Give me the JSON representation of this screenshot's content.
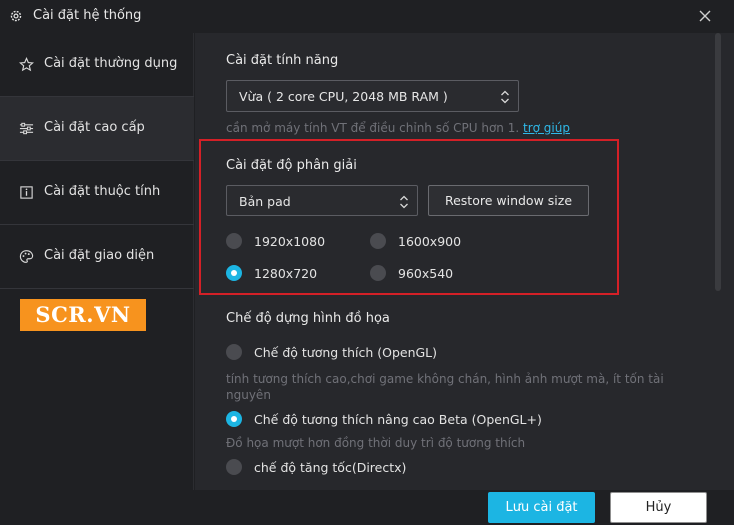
{
  "window": {
    "title": "Cài đặt hệ thống"
  },
  "sidebar": {
    "items": [
      {
        "label": "Cài đặt thường dụng",
        "icon": "star-icon"
      },
      {
        "label": "Cài đặt cao cấp",
        "icon": "sliders-icon"
      },
      {
        "label": "Cài đặt thuộc tính",
        "icon": "info-icon"
      },
      {
        "label": "Cài đặt giao diện",
        "icon": "palette-icon"
      }
    ],
    "active_index": 1
  },
  "watermark": {
    "text": "SCR.VN",
    "color": "#f7931e"
  },
  "features": {
    "title": "Cài đặt tính năng",
    "performance_value": "Vừa ( 2 core CPU, 2048 MB RAM )",
    "hint": "cần mở máy tính VT để điều chỉnh số CPU hơn 1.",
    "hint_link": "trợ giúp"
  },
  "resolution": {
    "title": "Cài đặt độ phân giải",
    "mode_value": "Bản pad",
    "restore_button": "Restore window size",
    "options": [
      {
        "label": "1920x1080",
        "checked": false
      },
      {
        "label": "1600x900",
        "checked": false
      },
      {
        "label": "1280x720",
        "checked": true
      },
      {
        "label": "960x540",
        "checked": false
      }
    ]
  },
  "graphics": {
    "title": "Chế độ dựng hình đồ họa",
    "options": [
      {
        "label": "Chế độ tương thích (OpenGL)",
        "checked": false,
        "desc_line1": "tính tương thích cao,chơi game không chán, hình ảnh mượt mà, ít tốn tài",
        "desc_line2": "nguyên"
      },
      {
        "label": "Chế độ tương thích nâng cao Beta (OpenGL+)",
        "checked": true,
        "desc_line1": "Đồ họa mượt hơn đồng thời duy trì độ tương thích"
      },
      {
        "label": "chế độ tăng tốc(Directx)",
        "checked": false
      }
    ]
  },
  "footer": {
    "save": "Lưu cài đặt",
    "cancel": "Hủy"
  },
  "colors": {
    "accent": "#1cb5e3",
    "highlight_box": "#d42027",
    "background": "#27282c"
  }
}
